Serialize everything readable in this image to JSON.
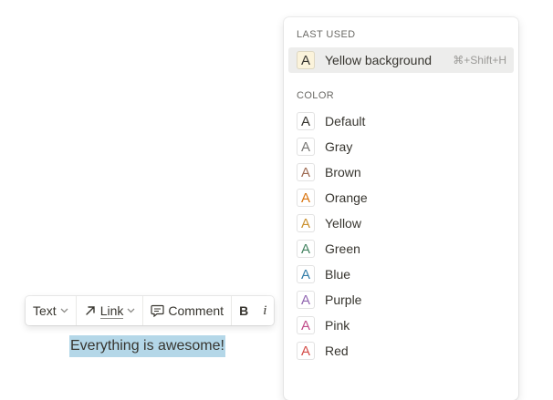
{
  "toolbar": {
    "text_label": "Text",
    "link_label": "Link",
    "comment_label": "Comment",
    "bold_label": "B",
    "italic_label": "i"
  },
  "editor": {
    "selected_text": "Everything is awesome!",
    "selection_color": "#b4d7e8"
  },
  "menu": {
    "last_used_title": "LAST USED",
    "last_used": {
      "glyph": "A",
      "label": "Yellow background",
      "shortcut": "⌘+Shift+H",
      "swatch_bg": "#fbf3db",
      "glyph_color": "#37352f"
    },
    "color_title": "COLOR",
    "colors": [
      {
        "glyph": "A",
        "label": "Default",
        "color": "#37352f"
      },
      {
        "glyph": "A",
        "label": "Gray",
        "color": "#787774"
      },
      {
        "glyph": "A",
        "label": "Brown",
        "color": "#9f6b53"
      },
      {
        "glyph": "A",
        "label": "Orange",
        "color": "#d9730d"
      },
      {
        "glyph": "A",
        "label": "Yellow",
        "color": "#cb912f"
      },
      {
        "glyph": "A",
        "label": "Green",
        "color": "#448361"
      },
      {
        "glyph": "A",
        "label": "Blue",
        "color": "#337ea9"
      },
      {
        "glyph": "A",
        "label": "Purple",
        "color": "#9065b0"
      },
      {
        "glyph": "A",
        "label": "Pink",
        "color": "#c14c8a"
      },
      {
        "glyph": "A",
        "label": "Red",
        "color": "#d44c47"
      }
    ]
  }
}
